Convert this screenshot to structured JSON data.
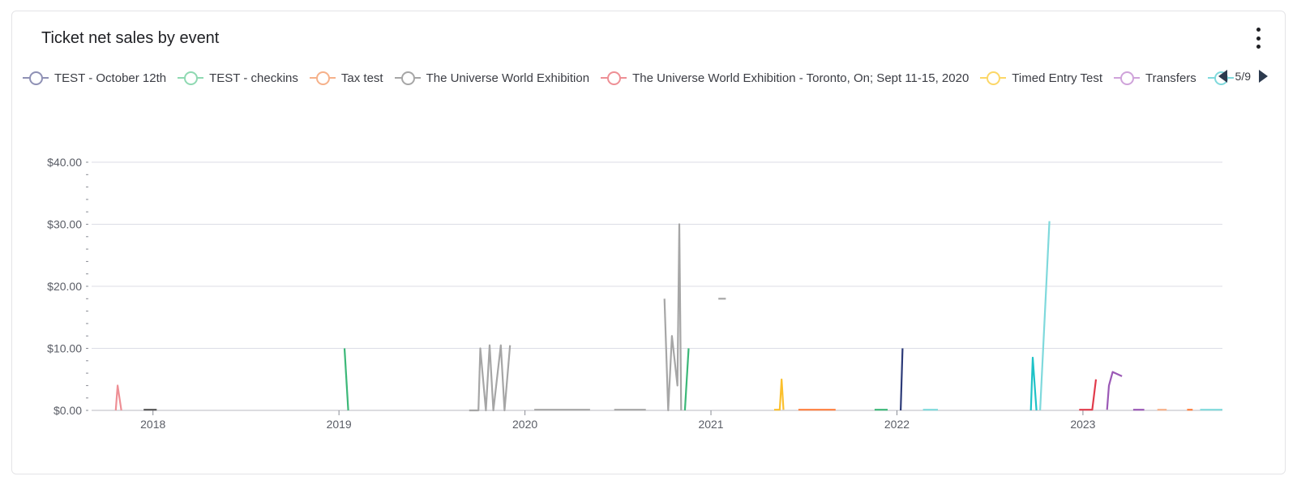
{
  "card": {
    "title": "Ticket net sales by event"
  },
  "legend": {
    "items": [
      {
        "label": "TEST - October 12th",
        "color": "#8f91b5"
      },
      {
        "label": "TEST - checkins",
        "color": "#8fd9b2"
      },
      {
        "label": "Tax test",
        "color": "#f6b18a"
      },
      {
        "label": "The Universe World Exhibition",
        "color": "#a6a6a6"
      },
      {
        "label": "The Universe World Exhibition - Toronto, On; Sept 11-15, 2020",
        "color": "#ee8f95"
      },
      {
        "label": "Timed Entry Test",
        "color": "#fcd767"
      },
      {
        "label": "Transfers",
        "color": "#cfa3da"
      },
      {
        "label": "",
        "color": "#7fd9dc"
      }
    ],
    "page": "5/9"
  },
  "chart_data": {
    "type": "line",
    "title": "Ticket net sales by event",
    "xlabel": "",
    "ylabel": "",
    "x_ticks": [
      "2018",
      "2019",
      "2020",
      "2021",
      "2022",
      "2023"
    ],
    "y_ticks": [
      "$0.00",
      "$10.00",
      "$20.00",
      "$30.00",
      "$40.00"
    ],
    "xlim": [
      2017.67,
      2023.75
    ],
    "ylim": [
      0,
      40
    ],
    "grid": true,
    "series": [
      {
        "color": "#ee8f95",
        "points": [
          [
            2017.8,
            0
          ],
          [
            2017.81,
            4
          ],
          [
            2017.83,
            0
          ]
        ]
      },
      {
        "color": "#555555",
        "points": [
          [
            2017.95,
            0.1
          ],
          [
            2018.02,
            0.1
          ]
        ]
      },
      {
        "color": "#3cb878",
        "points": [
          [
            2019.03,
            10
          ],
          [
            2019.05,
            0
          ]
        ]
      },
      {
        "color": "#a6a6a6",
        "points": [
          [
            2019.7,
            0
          ],
          [
            2019.75,
            0
          ],
          [
            2019.76,
            10
          ],
          [
            2019.79,
            0
          ],
          [
            2019.81,
            10.5
          ],
          [
            2019.83,
            0
          ],
          [
            2019.87,
            10.5
          ],
          [
            2019.89,
            0
          ],
          [
            2019.92,
            10.5
          ]
        ]
      },
      {
        "color": "#a6a6a6",
        "points": [
          [
            2020.05,
            0.1
          ],
          [
            2020.35,
            0.1
          ]
        ]
      },
      {
        "color": "#a6a6a6",
        "points": [
          [
            2020.48,
            0.1
          ],
          [
            2020.65,
            0.1
          ]
        ]
      },
      {
        "color": "#a6a6a6",
        "points": [
          [
            2020.75,
            18
          ],
          [
            2020.77,
            0
          ],
          [
            2020.79,
            12
          ],
          [
            2020.82,
            4
          ],
          [
            2020.83,
            30
          ],
          [
            2020.84,
            0
          ]
        ]
      },
      {
        "color": "#3cb878",
        "points": [
          [
            2020.86,
            0
          ],
          [
            2020.88,
            10
          ]
        ]
      },
      {
        "color": "#a6a6a6",
        "points": [
          [
            2021.04,
            18
          ],
          [
            2021.08,
            18
          ]
        ]
      },
      {
        "color": "#fbc02d",
        "points": [
          [
            2021.34,
            0.1
          ],
          [
            2021.37,
            0.1
          ],
          [
            2021.38,
            5
          ],
          [
            2021.39,
            0.1
          ]
        ]
      },
      {
        "color": "#ff7f3e",
        "points": [
          [
            2021.47,
            0.1
          ],
          [
            2021.67,
            0.1
          ]
        ]
      },
      {
        "color": "#3cb878",
        "points": [
          [
            2021.88,
            0.1
          ],
          [
            2021.95,
            0.1
          ]
        ]
      },
      {
        "color": "#2c3a78",
        "points": [
          [
            2022.02,
            0
          ],
          [
            2022.03,
            10
          ]
        ]
      },
      {
        "color": "#7fd9dc",
        "points": [
          [
            2022.14,
            0.1
          ],
          [
            2022.22,
            0.1
          ]
        ]
      },
      {
        "color": "#1fc2c7",
        "points": [
          [
            2022.72,
            0
          ],
          [
            2022.73,
            8.5
          ],
          [
            2022.75,
            0
          ]
        ]
      },
      {
        "color": "#7fd9dc",
        "points": [
          [
            2022.77,
            0
          ],
          [
            2022.82,
            30.5
          ]
        ]
      },
      {
        "color": "#e13b4b",
        "points": [
          [
            2022.98,
            0.1
          ],
          [
            2023.05,
            0.1
          ],
          [
            2023.07,
            5
          ]
        ]
      },
      {
        "color": "#9b59b6",
        "points": [
          [
            2023.13,
            0.1
          ],
          [
            2023.14,
            4
          ],
          [
            2023.16,
            6.2
          ],
          [
            2023.21,
            5.5
          ]
        ]
      },
      {
        "color": "#9b59b6",
        "points": [
          [
            2023.27,
            0.1
          ],
          [
            2023.33,
            0.1
          ]
        ]
      },
      {
        "color": "#f6b18a",
        "points": [
          [
            2023.4,
            0.1
          ],
          [
            2023.45,
            0.1
          ]
        ]
      },
      {
        "color": "#ff7f3e",
        "points": [
          [
            2023.56,
            0.1
          ],
          [
            2023.59,
            0.1
          ]
        ]
      },
      {
        "color": "#7fd9dc",
        "points": [
          [
            2023.63,
            0.1
          ],
          [
            2023.75,
            0.1
          ]
        ]
      }
    ]
  }
}
